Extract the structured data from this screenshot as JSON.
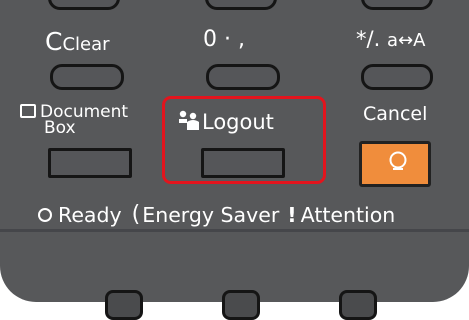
{
  "keys": {
    "clear_label": "Clear",
    "zero_label": "0 · ,",
    "percent_label": "¹⁄₀",
    "input_mode_label": "a↔A",
    "document_box_line1": "Document",
    "document_box_line2": "Box",
    "logout_label": "Logout",
    "cancel_label": "Cancel"
  },
  "status": {
    "ready_label": "Ready",
    "energy_saver_label": "Energy Saver",
    "attention_label": "Attention"
  },
  "colors": {
    "panel": "#57585a",
    "highlight": "#e3141d",
    "cancel": "#f08d3c"
  }
}
